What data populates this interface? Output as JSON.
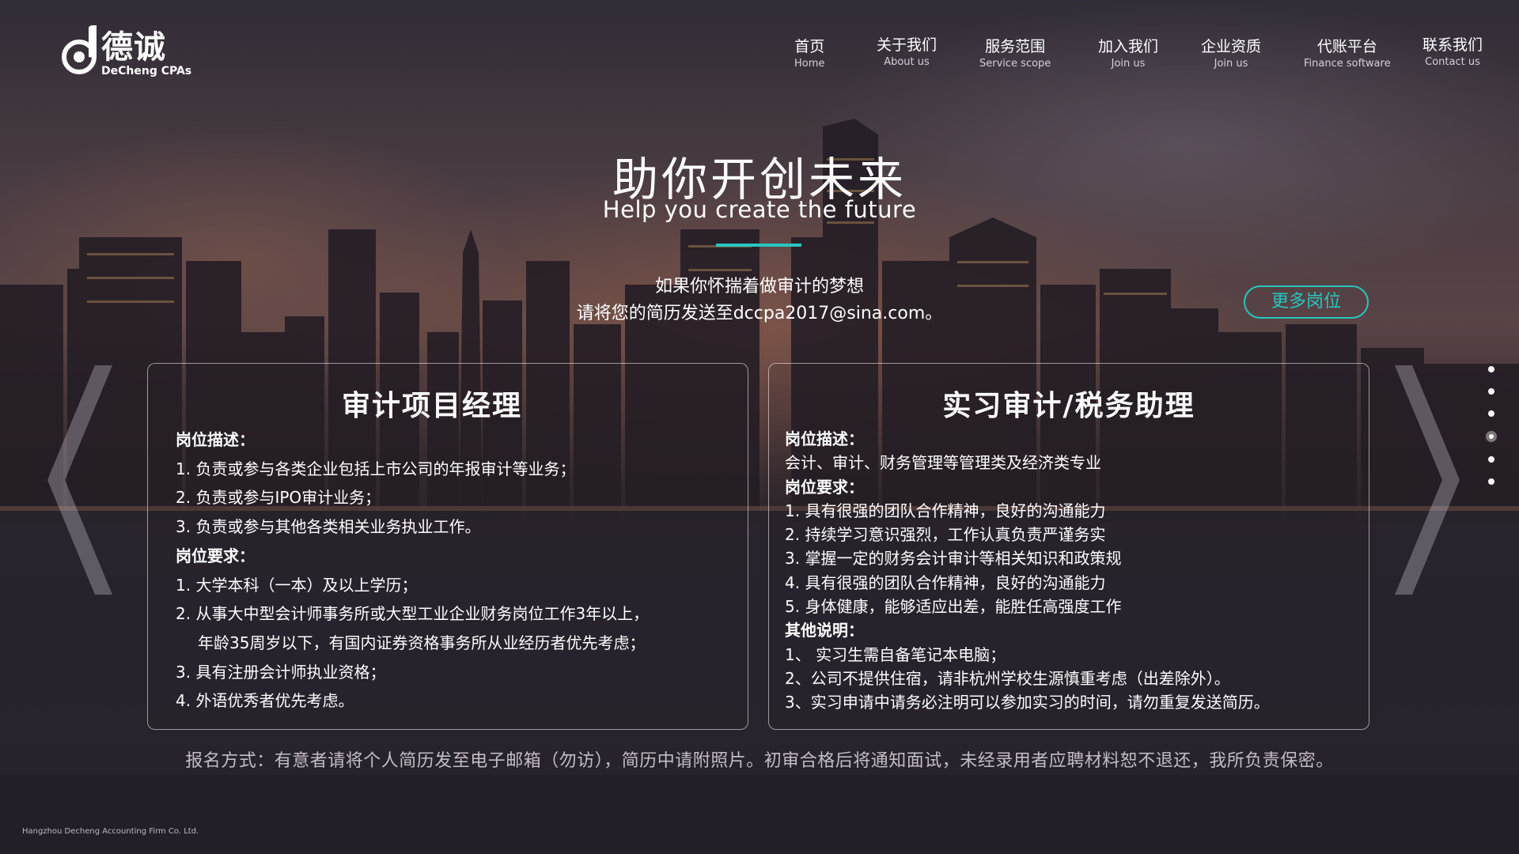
{
  "brand": {
    "name_cn": "德诚",
    "name_en": "DeCheng CPAs"
  },
  "nav": [
    {
      "cn": "首页",
      "en": "Home"
    },
    {
      "cn": "关于我们",
      "en": "About us"
    },
    {
      "cn": "服务范围",
      "en": "Service scope"
    },
    {
      "cn": "加入我们",
      "en": "Join us"
    },
    {
      "cn": "企业资质",
      "en": "Join us"
    },
    {
      "cn": "代账平台",
      "en": "Finance software"
    },
    {
      "cn": "联系我们",
      "en": "Contact us"
    }
  ],
  "hero": {
    "title": "助你开创未来",
    "subtitle": "Help you create the future",
    "intro_line1": "如果你怀揣着做审计的梦想",
    "intro_line2": "请将您的简历发送至dccpa2017@sina.com。"
  },
  "more_button": "更多岗位",
  "jobs": [
    {
      "title": "审计项目经理",
      "desc_label": "岗位描述：",
      "desc": [
        "1.  负责或参与各类企业包括上市公司的年报审计等业务；",
        "2. 负责或参与IPO审计业务；",
        "3. 负责或参与其他各类相关业务执业工作。"
      ],
      "req_label": "岗位要求：",
      "req": [
        "1.  大学本科（一本）及以上学历；",
        "2.  从事大中型会计师事务所或大型工业企业财务岗位工作3年以上，",
        "年龄35周岁以下，有国内证券资格事务所从业经历者优先考虑；",
        "3.  具有注册会计师执业资格；",
        "4.  外语优秀者优先考虑。"
      ]
    },
    {
      "title": "实习审计/税务助理",
      "desc_label": "岗位描述：",
      "desc": [
        "会计、审计、财务管理等管理类及经济类专业"
      ],
      "req_label": "岗位要求：",
      "req": [
        "1.  具有很强的团队合作精神，良好的沟通能力",
        "2.  持续学习意识强烈，工作认真负责严谨务实",
        "3.  掌握一定的财务会计审计等相关知识和政策规",
        "4.  具有很强的团队合作精神，良好的沟通能力",
        "5.  身体健康，能够适应出差，能胜任高强度工作"
      ],
      "other_label": "其他说明：",
      "other": [
        "1、  实习生需自备笔记本电脑；",
        "2、公司不提供住宿，请非杭州学校生源慎重考虑（出差除外）。",
        "3、实习申请中请务必注明可以参加实习的时间，请勿重复发送简历。"
      ]
    }
  ],
  "pager": {
    "count": 6,
    "active": 4
  },
  "footer_note": "报名方式：有意者请将个人简历发至电子邮箱（勿访），简历中请附照片。初审合格后将通知面试，未经录用者应聘材料恕不退还，我所负责保密。",
  "copyright": "Hangzhou Decheng Accounting Firm Co. Ltd.",
  "colors": {
    "accent": "#27c6c0"
  }
}
